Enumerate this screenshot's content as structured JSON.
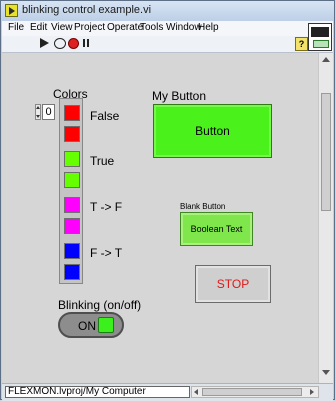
{
  "window": {
    "title": "blinking control example.vi"
  },
  "menu": [
    "File",
    "Edit",
    "View",
    "Project",
    "Operate",
    "Tools",
    "Window",
    "Help"
  ],
  "toolbar": {
    "icons": [
      "run-arrow-icon",
      "run-continuously-icon",
      "abort-icon",
      "pause-icon",
      "help-icon"
    ],
    "help_glyph": "?"
  },
  "colors_array": {
    "label": "Colors",
    "index_value": "0",
    "swatches": [
      "#ff0000",
      "#ff0000",
      "#66ff00",
      "#66ff00",
      "#ff00ff",
      "#ff00ff",
      "#0000ff",
      "#0000ff"
    ],
    "pair_labels": [
      "False",
      "True",
      "T -> F",
      "F -> T"
    ]
  },
  "my_button": {
    "label": "My Button",
    "text": "Button",
    "color": "#4bf11b"
  },
  "blank_button": {
    "label": "Blank Button",
    "text": "Boolean Text",
    "color": "#7fe64c"
  },
  "stop_button": {
    "text": "STOP",
    "text_color": "#e01818"
  },
  "blinking": {
    "label": "Blinking (on/off)",
    "state_text": "ON",
    "led_color": "#3cf01d"
  },
  "statusbar": {
    "path": "FLEXMON.lvproj/My Computer"
  }
}
